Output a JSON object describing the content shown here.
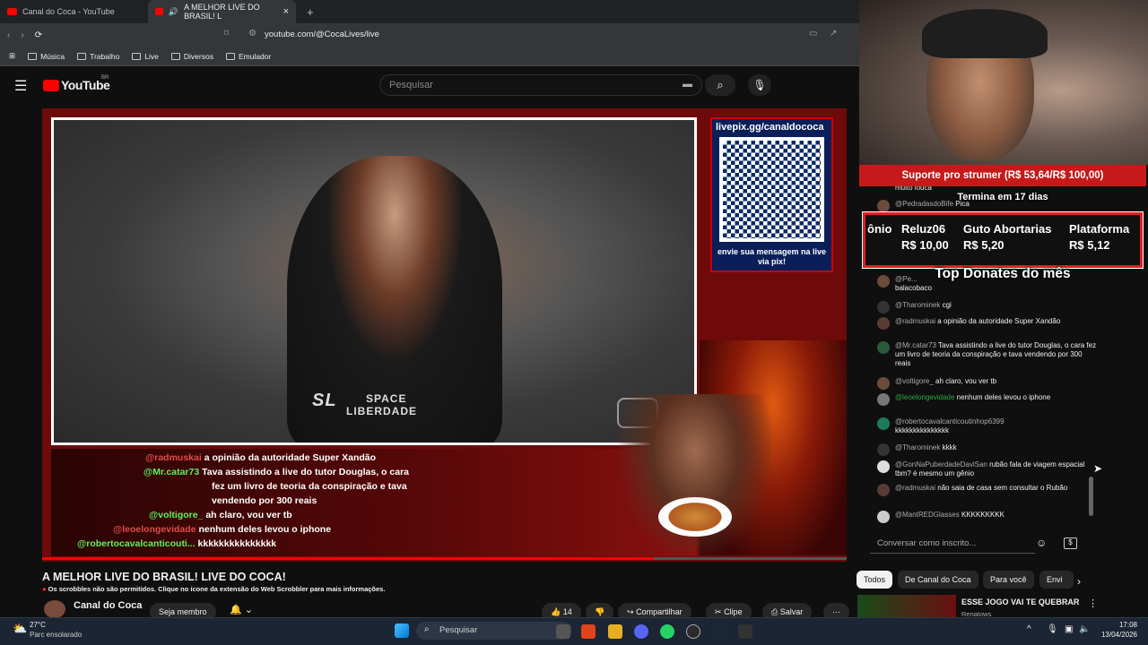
{
  "browser": {
    "tabs": [
      {
        "label": "Canal do Coca - YouTube"
      },
      {
        "label": "A MELHOR LIVE DO BRASIL! L"
      }
    ],
    "url": "youtube.com/@CocaLives/live",
    "bookmarks": [
      "Música",
      "Trabalho",
      "Live",
      "Diversos",
      "Emulador"
    ]
  },
  "youtube": {
    "logo": "YouTube",
    "region": "BR",
    "search_placeholder": "Pesquisar"
  },
  "overlay": {
    "pix_title": "livepix.gg/canaldococa",
    "pix_text": "envie sua mensagem na live via pix!",
    "sl_logo_line1": "SPACE",
    "sl_logo_line2": "LIBERDADE",
    "sl_mark": "SL",
    "chat_lines": [
      {
        "name": "@radmuskai",
        "text": "a opinião da autoridade Super Xandão"
      },
      {
        "name": "@Mr.catar73",
        "text": "Tava assistindo a live do tutor Douglas, o cara"
      },
      {
        "name": "",
        "text": "fez um livro de teoria da conspiração e tava"
      },
      {
        "name": "",
        "text": "vendendo por 300 reais"
      },
      {
        "name": "@voltigore_",
        "text": "ah claro, vou ver tb"
      },
      {
        "name": "@leoelongevidade",
        "text": "nenhum deles levou o iphone"
      },
      {
        "name": "@robertocavalcanticouti...",
        "text": "kkkkkkkkkkkkkkk"
      }
    ],
    "support": "Suporte pro strumer (R$ 53,64/R$ 100,00)",
    "support_fraction": 0.5364,
    "termina": "Termina em 17 dias",
    "top_donates_title": "Top Donates do mês",
    "donors": [
      {
        "name": "ônio",
        "amount": ""
      },
      {
        "name": "Reluz06",
        "amount": "R$ 10,00"
      },
      {
        "name": "Guto Abortarias",
        "amount": "R$ 5,20"
      },
      {
        "name": "Plataforma",
        "amount": "R$ 5,12"
      }
    ]
  },
  "video": {
    "title": "A MELHOR LIVE DO BRASIL! LIVE DO COCA!",
    "scrobble_notice": "Os scrobbles não são permitidos. Clique no ícone da extensão do Web Scrobbler para mais informações.",
    "channel": "Canal do Coca",
    "member_button": "Seja membro",
    "likes": "14",
    "share": "Compartilhar",
    "clip": "Clipe",
    "save": "Salvar",
    "progress_fraction": 0.76
  },
  "chat": {
    "messages": [
      {
        "author": "",
        "text": "muito louca"
      },
      {
        "author": "@PedradasdoBife",
        "text": "Pica"
      },
      {
        "author": "@Pe...",
        "text": "balacobaco"
      },
      {
        "author": "@Tharominek",
        "text": "cgi"
      },
      {
        "author": "@radmuskai",
        "text": "a opinião da autoridade Super Xandão"
      },
      {
        "author": "@Mr.catar73",
        "text": "Tava assistindo a live do tutor Douglas, o cara fez um livro de teoria da conspiração e tava vendendo por 300 reais"
      },
      {
        "author": "@voltigore_",
        "text": "ah claro, vou ver tb"
      },
      {
        "author": "@leoelongevidade",
        "text": "nenhum deles levou o iphone"
      },
      {
        "author": "@robertocavalcanticoutinhop6399",
        "text": "kkkkkkkkkkkkkkk"
      },
      {
        "author": "@Tharominek",
        "text": "kkkk"
      },
      {
        "author": "@GonNaPuberdadeDaviSan",
        "text": "rubão fala de viagem espacial tbm? é mesmo um gênio"
      },
      {
        "author": "@radmuskai",
        "text": "não saia de casa sem consultar o Rubão"
      },
      {
        "author": "@MantREDGlasses",
        "text": "KKKKKKKKK"
      }
    ],
    "input_placeholder": "Conversar como inscrito..."
  },
  "related": {
    "chips": [
      "Todos",
      "De Canal do Coca",
      "Para você",
      "Envi"
    ],
    "first_title": "ESSE JOGO VAI TE QUEBRAR",
    "first_channel": "Renatows"
  },
  "taskbar": {
    "temp": "27°C",
    "weather": "Parc ensolarado",
    "search": "Pesquisar",
    "time": "17:08",
    "date": "13/04/2026"
  }
}
